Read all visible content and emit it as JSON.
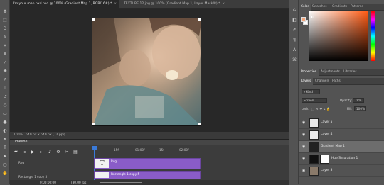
{
  "tabs": [
    {
      "label": "I'm your man pxd.psd @ 100% (Gradient Map 1, RGB/16#) *",
      "active": true
    },
    {
      "label": "TEXTURE 12.jpg @ 100% (Gradient Map 1, Layer Mask/8) *",
      "active": false
    }
  ],
  "status": {
    "zoom": "100%",
    "doc_size": "540 px x 540 px (72 ppi)"
  },
  "timeline": {
    "title": "Timeline",
    "ticks": [
      "15f",
      "01:00f",
      "15f",
      "02:00f"
    ],
    "tracks": [
      {
        "label": "Rvg",
        "clip": "Rvg"
      },
      {
        "label": "Rectangle 1 copy 5",
        "clip": "Rectangle 1 copy 5"
      }
    ],
    "timecode": "0:00:00:00",
    "fps": "(30.00 fps)"
  },
  "color_panel": {
    "tabs": [
      "Color",
      "Swatches",
      "Gradients",
      "Patterns"
    ],
    "active": "Color",
    "foreground": "#f2a47a",
    "background": "#ffffff"
  },
  "properties_tabs": [
    "Properties",
    "Adjustments",
    "Libraries"
  ],
  "layers_panel": {
    "tabs": [
      "Layers",
      "Channels",
      "Paths"
    ],
    "filter": "Kind",
    "blend_mode": "Screen",
    "opacity_label": "Opacity:",
    "opacity": "79%",
    "lock_label": "Lock:",
    "fill_label": "Fill:",
    "fill": "100%",
    "layers": [
      {
        "name": "Layer 5",
        "selected": false,
        "thumb": "#e8e8e8"
      },
      {
        "name": "Layer 4",
        "selected": false,
        "thumb": "#e8e8e8"
      },
      {
        "name": "Gradient Map 1",
        "selected": true,
        "thumb": "#222222"
      },
      {
        "name": "Hue/Saturation 1",
        "selected": false,
        "thumb": "#111111"
      },
      {
        "name": "Layer 3",
        "selected": false,
        "thumb": "#8a7a6a"
      }
    ]
  }
}
